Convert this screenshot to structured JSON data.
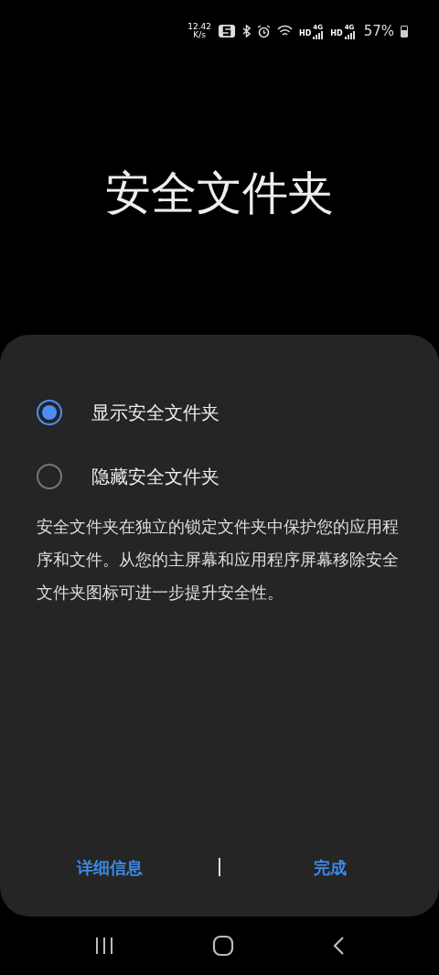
{
  "status_bar": {
    "speed_value": "12.42",
    "speed_unit": "K/s",
    "sims": [
      {
        "hd": "HD",
        "net": "4G"
      },
      {
        "hd": "HD",
        "net": "4G"
      }
    ],
    "battery": "57%"
  },
  "title": "安全文件夹",
  "options": [
    {
      "label": "显示安全文件夹",
      "selected": true
    },
    {
      "label": "隐藏安全文件夹",
      "selected": false
    }
  ],
  "description": "安全文件夹在独立的锁定文件夹中保护您的应用程序和文件。从您的主屏幕和应用程序屏幕移除安全文件夹图标可进一步提升安全性。",
  "buttons": [
    "详细信息",
    "完成"
  ]
}
